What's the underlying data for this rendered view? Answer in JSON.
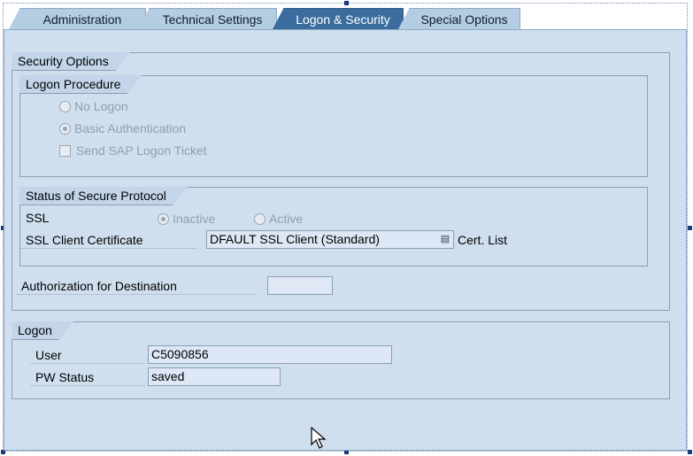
{
  "tabs": [
    {
      "label": "Administration",
      "active": false
    },
    {
      "label": "Technical Settings",
      "active": false
    },
    {
      "label": "Logon & Security",
      "active": true
    },
    {
      "label": "Special Options",
      "active": false
    }
  ],
  "security_options": {
    "title": "Security Options",
    "logon_procedure": {
      "title": "Logon Procedure",
      "no_logon": "No Logon",
      "basic_auth": "Basic Authentication",
      "send_ticket": "Send SAP Logon Ticket",
      "selected": "basic_auth"
    },
    "secure_protocol": {
      "title": "Status of Secure Protocol",
      "ssl_label": "SSL",
      "inactive": "Inactive",
      "active": "Active",
      "selected": "inactive",
      "cert_label": "SSL Client Certificate",
      "cert_value": "DFAULT SSL Client (Standard)",
      "cert_list": "Cert. List"
    },
    "auth_dest_label": "Authorization for Destination",
    "auth_dest_value": ""
  },
  "logon": {
    "title": "Logon",
    "user_label": "User",
    "user_value": "C5090856",
    "pw_label": "PW Status",
    "pw_value": "saved"
  },
  "icons": {
    "dropdown": "list-icon",
    "cursor": "mouse-pointer-icon"
  },
  "colors": {
    "active_tab": "#3a6d9e",
    "panel_bg": "#cfdfee",
    "inactive_tab": "#b5cde3"
  }
}
